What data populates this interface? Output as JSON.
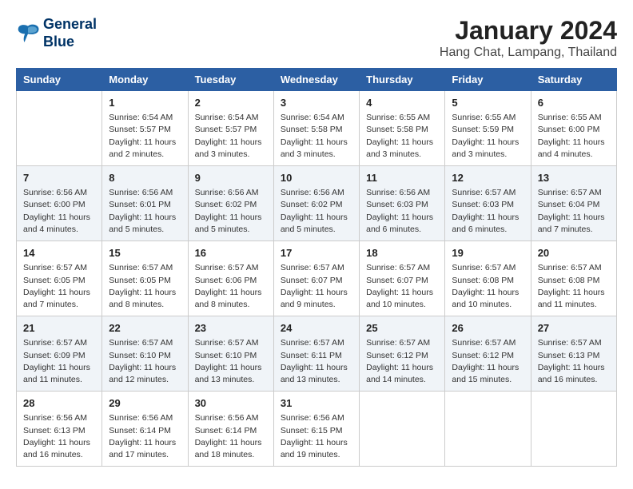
{
  "header": {
    "logo_line1": "General",
    "logo_line2": "Blue",
    "main_title": "January 2024",
    "subtitle": "Hang Chat, Lampang, Thailand"
  },
  "weekdays": [
    "Sunday",
    "Monday",
    "Tuesday",
    "Wednesday",
    "Thursday",
    "Friday",
    "Saturday"
  ],
  "weeks": [
    [
      {
        "day": "",
        "info": ""
      },
      {
        "day": "1",
        "info": "Sunrise: 6:54 AM\nSunset: 5:57 PM\nDaylight: 11 hours\nand 2 minutes."
      },
      {
        "day": "2",
        "info": "Sunrise: 6:54 AM\nSunset: 5:57 PM\nDaylight: 11 hours\nand 3 minutes."
      },
      {
        "day": "3",
        "info": "Sunrise: 6:54 AM\nSunset: 5:58 PM\nDaylight: 11 hours\nand 3 minutes."
      },
      {
        "day": "4",
        "info": "Sunrise: 6:55 AM\nSunset: 5:58 PM\nDaylight: 11 hours\nand 3 minutes."
      },
      {
        "day": "5",
        "info": "Sunrise: 6:55 AM\nSunset: 5:59 PM\nDaylight: 11 hours\nand 3 minutes."
      },
      {
        "day": "6",
        "info": "Sunrise: 6:55 AM\nSunset: 6:00 PM\nDaylight: 11 hours\nand 4 minutes."
      }
    ],
    [
      {
        "day": "7",
        "info": "Sunrise: 6:56 AM\nSunset: 6:00 PM\nDaylight: 11 hours\nand 4 minutes."
      },
      {
        "day": "8",
        "info": "Sunrise: 6:56 AM\nSunset: 6:01 PM\nDaylight: 11 hours\nand 5 minutes."
      },
      {
        "day": "9",
        "info": "Sunrise: 6:56 AM\nSunset: 6:02 PM\nDaylight: 11 hours\nand 5 minutes."
      },
      {
        "day": "10",
        "info": "Sunrise: 6:56 AM\nSunset: 6:02 PM\nDaylight: 11 hours\nand 5 minutes."
      },
      {
        "day": "11",
        "info": "Sunrise: 6:56 AM\nSunset: 6:03 PM\nDaylight: 11 hours\nand 6 minutes."
      },
      {
        "day": "12",
        "info": "Sunrise: 6:57 AM\nSunset: 6:03 PM\nDaylight: 11 hours\nand 6 minutes."
      },
      {
        "day": "13",
        "info": "Sunrise: 6:57 AM\nSunset: 6:04 PM\nDaylight: 11 hours\nand 7 minutes."
      }
    ],
    [
      {
        "day": "14",
        "info": "Sunrise: 6:57 AM\nSunset: 6:05 PM\nDaylight: 11 hours\nand 7 minutes."
      },
      {
        "day": "15",
        "info": "Sunrise: 6:57 AM\nSunset: 6:05 PM\nDaylight: 11 hours\nand 8 minutes."
      },
      {
        "day": "16",
        "info": "Sunrise: 6:57 AM\nSunset: 6:06 PM\nDaylight: 11 hours\nand 8 minutes."
      },
      {
        "day": "17",
        "info": "Sunrise: 6:57 AM\nSunset: 6:07 PM\nDaylight: 11 hours\nand 9 minutes."
      },
      {
        "day": "18",
        "info": "Sunrise: 6:57 AM\nSunset: 6:07 PM\nDaylight: 11 hours\nand 10 minutes."
      },
      {
        "day": "19",
        "info": "Sunrise: 6:57 AM\nSunset: 6:08 PM\nDaylight: 11 hours\nand 10 minutes."
      },
      {
        "day": "20",
        "info": "Sunrise: 6:57 AM\nSunset: 6:08 PM\nDaylight: 11 hours\nand 11 minutes."
      }
    ],
    [
      {
        "day": "21",
        "info": "Sunrise: 6:57 AM\nSunset: 6:09 PM\nDaylight: 11 hours\nand 11 minutes."
      },
      {
        "day": "22",
        "info": "Sunrise: 6:57 AM\nSunset: 6:10 PM\nDaylight: 11 hours\nand 12 minutes."
      },
      {
        "day": "23",
        "info": "Sunrise: 6:57 AM\nSunset: 6:10 PM\nDaylight: 11 hours\nand 13 minutes."
      },
      {
        "day": "24",
        "info": "Sunrise: 6:57 AM\nSunset: 6:11 PM\nDaylight: 11 hours\nand 13 minutes."
      },
      {
        "day": "25",
        "info": "Sunrise: 6:57 AM\nSunset: 6:12 PM\nDaylight: 11 hours\nand 14 minutes."
      },
      {
        "day": "26",
        "info": "Sunrise: 6:57 AM\nSunset: 6:12 PM\nDaylight: 11 hours\nand 15 minutes."
      },
      {
        "day": "27",
        "info": "Sunrise: 6:57 AM\nSunset: 6:13 PM\nDaylight: 11 hours\nand 16 minutes."
      }
    ],
    [
      {
        "day": "28",
        "info": "Sunrise: 6:56 AM\nSunset: 6:13 PM\nDaylight: 11 hours\nand 16 minutes."
      },
      {
        "day": "29",
        "info": "Sunrise: 6:56 AM\nSunset: 6:14 PM\nDaylight: 11 hours\nand 17 minutes."
      },
      {
        "day": "30",
        "info": "Sunrise: 6:56 AM\nSunset: 6:14 PM\nDaylight: 11 hours\nand 18 minutes."
      },
      {
        "day": "31",
        "info": "Sunrise: 6:56 AM\nSunset: 6:15 PM\nDaylight: 11 hours\nand 19 minutes."
      },
      {
        "day": "",
        "info": ""
      },
      {
        "day": "",
        "info": ""
      },
      {
        "day": "",
        "info": ""
      }
    ]
  ]
}
